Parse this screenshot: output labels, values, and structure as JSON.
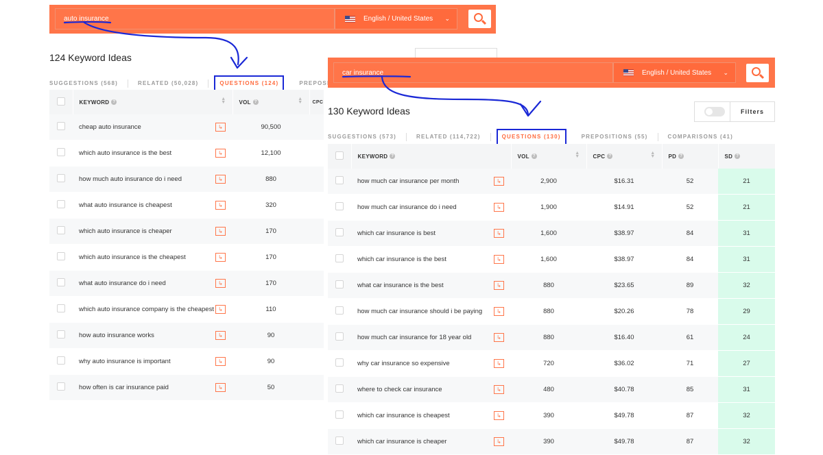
{
  "panel1": {
    "search": {
      "query": "auto insurance",
      "language": "English / United States"
    },
    "heading": "124 Keyword Ideas",
    "tabs": [
      {
        "label": "SUGGESTIONS (568)",
        "active": false
      },
      {
        "label": "RELATED (50,028)",
        "active": false
      },
      {
        "label": "QUESTIONS (124)",
        "active": true
      },
      {
        "label": "PREPOSI",
        "active": false
      }
    ],
    "columns": {
      "keyword": "KEYWORD",
      "vol": "VOL",
      "cpc": "CPC"
    },
    "rows": [
      {
        "keyword": "cheap auto insurance",
        "vol": "90,500"
      },
      {
        "keyword": "which auto insurance is the best",
        "vol": "12,100"
      },
      {
        "keyword": "how much auto insurance do i need",
        "vol": "880"
      },
      {
        "keyword": "what auto insurance is cheapest",
        "vol": "320"
      },
      {
        "keyword": "which auto insurance is cheaper",
        "vol": "170"
      },
      {
        "keyword": "which auto insurance is the cheapest",
        "vol": "170"
      },
      {
        "keyword": "what auto insurance do i need",
        "vol": "170"
      },
      {
        "keyword": "which auto insurance company is the cheapest",
        "vol": "110"
      },
      {
        "keyword": "how auto insurance works",
        "vol": "90"
      },
      {
        "keyword": "why auto insurance is important",
        "vol": "90"
      },
      {
        "keyword": "how often is car insurance paid",
        "vol": "50"
      }
    ]
  },
  "panel2": {
    "search": {
      "query": "car insurance",
      "language": "English / United States"
    },
    "heading": "130 Keyword Ideas",
    "filters_label": "Filters",
    "tabs": [
      {
        "label": "SUGGESTIONS (573)",
        "active": false
      },
      {
        "label": "RELATED (114,722)",
        "active": false
      },
      {
        "label": "QUESTIONS (130)",
        "active": true
      },
      {
        "label": "PREPOSITIONS (55)",
        "active": false
      },
      {
        "label": "COMPARISONS (41)",
        "active": false
      }
    ],
    "columns": {
      "keyword": "KEYWORD",
      "vol": "VOL",
      "cpc": "CPC",
      "pd": "PD",
      "sd": "SD"
    },
    "rows": [
      {
        "keyword": "how much car insurance per month",
        "vol": "2,900",
        "cpc": "$16.31",
        "pd": "52",
        "sd": "21"
      },
      {
        "keyword": "how much car insurance do i need",
        "vol": "1,900",
        "cpc": "$14.91",
        "pd": "52",
        "sd": "21"
      },
      {
        "keyword": "which car insurance is best",
        "vol": "1,600",
        "cpc": "$38.97",
        "pd": "84",
        "sd": "31"
      },
      {
        "keyword": "which car insurance is the best",
        "vol": "1,600",
        "cpc": "$38.97",
        "pd": "84",
        "sd": "31"
      },
      {
        "keyword": "what car insurance is the best",
        "vol": "880",
        "cpc": "$23.65",
        "pd": "89",
        "sd": "32"
      },
      {
        "keyword": "how much car insurance should i be paying",
        "vol": "880",
        "cpc": "$20.26",
        "pd": "78",
        "sd": "29"
      },
      {
        "keyword": "how much car insurance for 18 year old",
        "vol": "880",
        "cpc": "$16.40",
        "pd": "61",
        "sd": "24"
      },
      {
        "keyword": "why car insurance so expensive",
        "vol": "720",
        "cpc": "$36.02",
        "pd": "71",
        "sd": "27"
      },
      {
        "keyword": "where to check car insurance",
        "vol": "480",
        "cpc": "$40.78",
        "pd": "85",
        "sd": "31"
      },
      {
        "keyword": "which car insurance is cheapest",
        "vol": "390",
        "cpc": "$49.78",
        "pd": "87",
        "sd": "32"
      },
      {
        "keyword": "which car insurance is cheaper",
        "vol": "390",
        "cpc": "$49.78",
        "pd": "87",
        "sd": "32"
      }
    ]
  },
  "colors": {
    "brand_orange": "#ff7549",
    "annotation_blue": "#1a28d6",
    "sd_green": "#d9fbeb"
  },
  "icons": {
    "search": "search-icon",
    "flag": "us-flag-icon",
    "row_action": "open-serp-icon",
    "help": "help-icon",
    "sort": "sort-icon"
  }
}
